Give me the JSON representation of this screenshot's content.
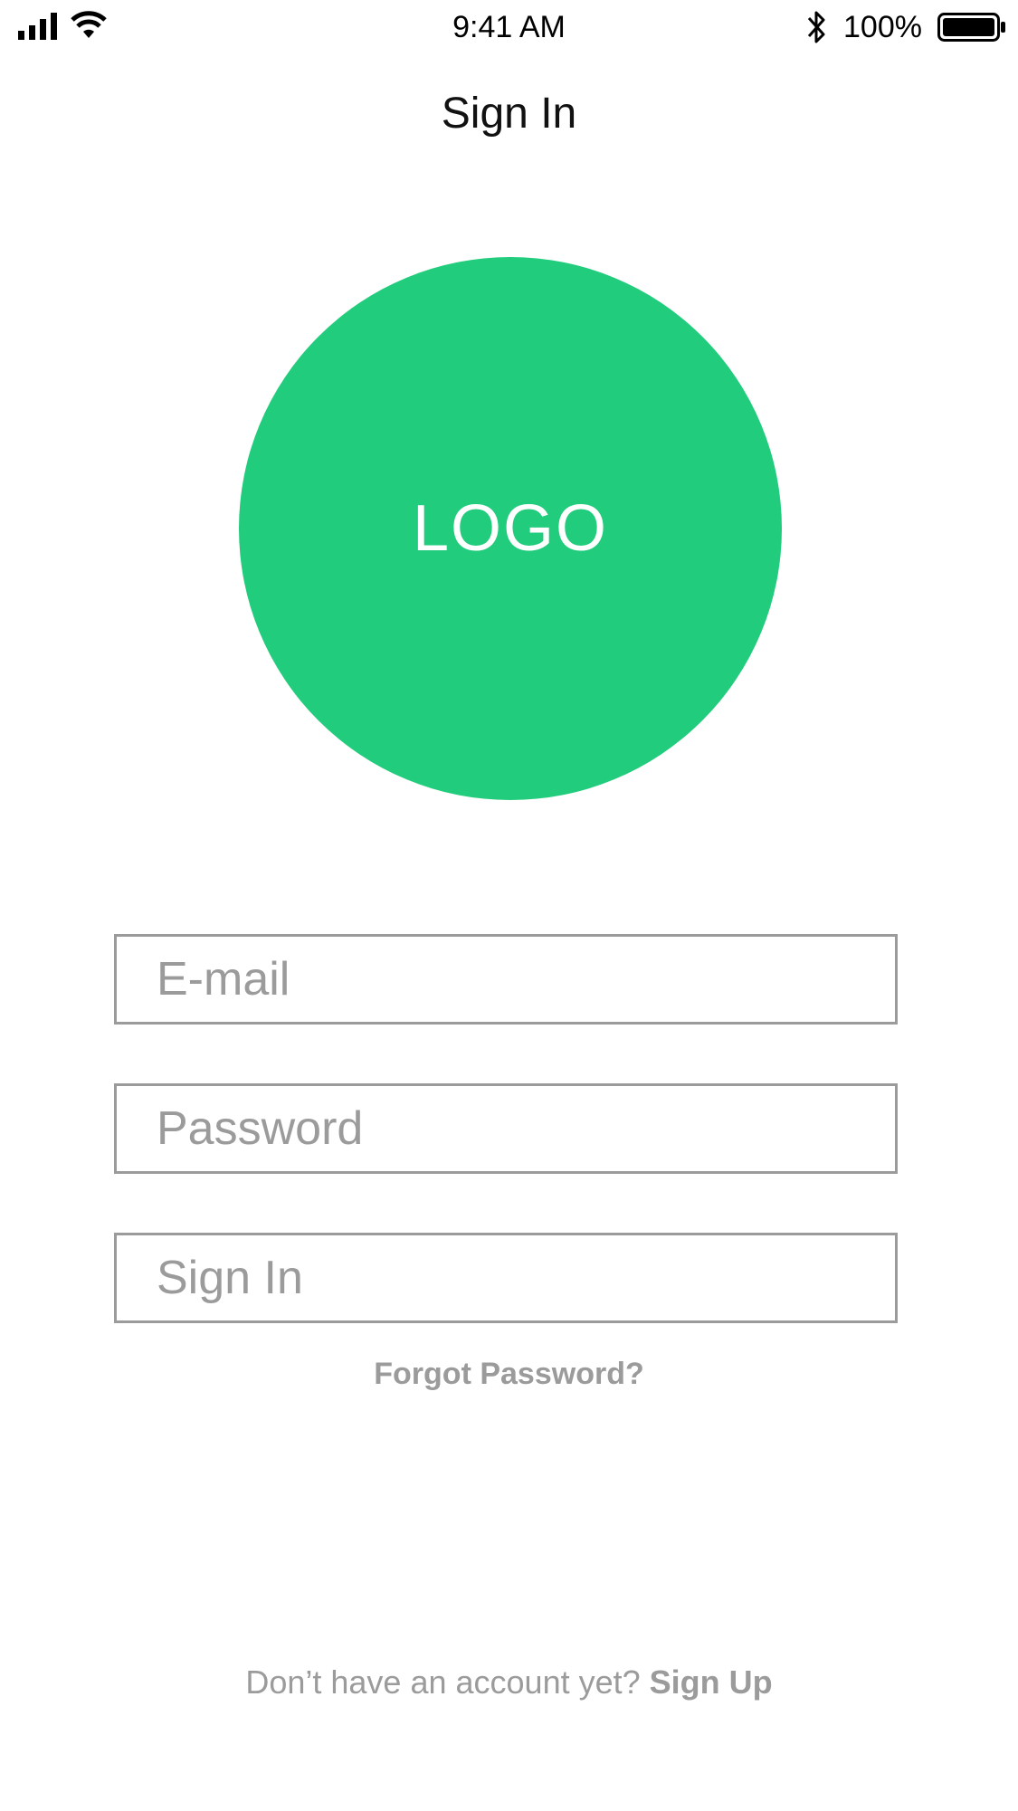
{
  "status_bar": {
    "time": "9:41 AM",
    "battery_percent": "100%",
    "icons": [
      "signal-icon",
      "wifi-icon",
      "bluetooth-icon",
      "battery-icon"
    ]
  },
  "header": {
    "title": "Sign In"
  },
  "logo": {
    "text": "LOGO",
    "color": "#21cc7c"
  },
  "form": {
    "email_placeholder": "E-mail",
    "password_placeholder": "Password",
    "submit_label": "Sign In",
    "forgot_password": "Forgot Password?"
  },
  "footer": {
    "prompt": "Don’t have an account yet?",
    "signup_label": "Sign Up"
  },
  "colors": {
    "accent": "#21cc7c",
    "muted_text": "#9b9b9b",
    "border": "#9b9b9b"
  }
}
